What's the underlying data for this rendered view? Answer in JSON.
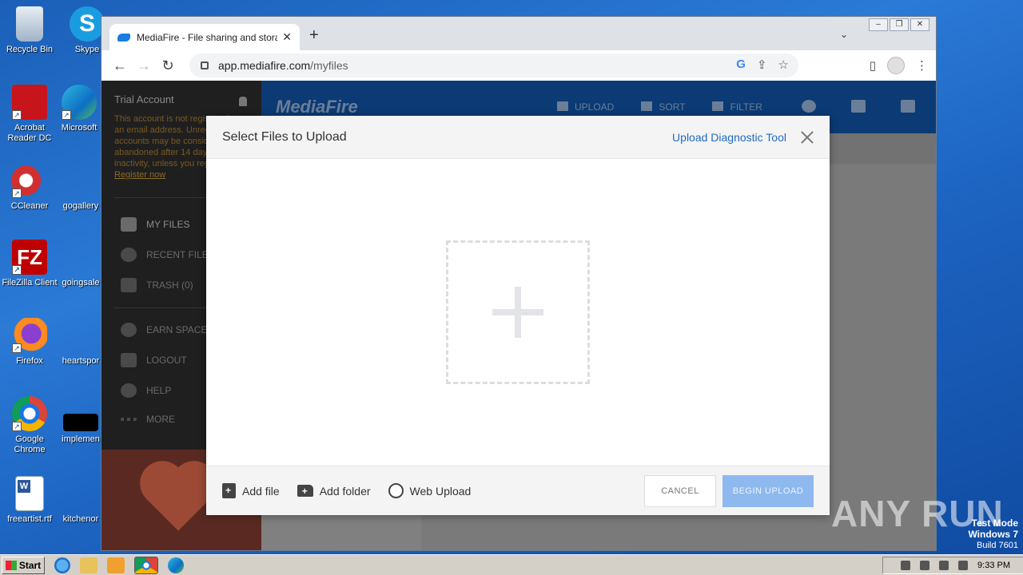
{
  "desktop": {
    "icons": [
      {
        "label": "Recycle Bin"
      },
      {
        "label": "Skype"
      },
      {
        "label": "Acrobat Reader DC"
      },
      {
        "label": "Microsoft"
      },
      {
        "label": "CCleaner"
      },
      {
        "label": "gogallery"
      },
      {
        "label": "FileZilla Client"
      },
      {
        "label": "goingsale"
      },
      {
        "label": "Firefox"
      },
      {
        "label": "heartspor"
      },
      {
        "label": "Google Chrome"
      },
      {
        "label": "implemen"
      },
      {
        "label": "freeartist.rtf"
      },
      {
        "label": "kitchenor"
      }
    ]
  },
  "browser": {
    "tab_title": "MediaFire - File sharing and storage",
    "url_host": "app.mediafire.com",
    "url_path": "/myfiles"
  },
  "mediafire": {
    "logo": "MediaFire",
    "sidebar": {
      "account_title": "Trial Account",
      "trial_notice": "This account is not registered to an email address. Unregistered accounts may be considered abandoned after 14 days of inactivity, unless you register.",
      "register_link": "Register now",
      "items": [
        {
          "label": "MY FILES"
        },
        {
          "label": "RECENT FILES"
        },
        {
          "label": "TRASH (0)"
        },
        {
          "label": "EARN SPACE"
        },
        {
          "label": "LOGOUT"
        },
        {
          "label": "HELP"
        },
        {
          "label": "MORE"
        }
      ]
    },
    "nav": {
      "upload": "UPLOAD",
      "sort": "SORT",
      "filter": "FILTER"
    }
  },
  "modal": {
    "title": "Select Files to Upload",
    "diagnostic_link": "Upload Diagnostic Tool",
    "add_file": "Add file",
    "add_folder": "Add folder",
    "web_upload": "Web Upload",
    "cancel": "CANCEL",
    "begin_upload": "BEGIN UPLOAD"
  },
  "watermark": "ANY RUN",
  "os_overlay": {
    "line1": "Test Mode",
    "line2": "Windows 7",
    "line3": "Build 7601"
  },
  "taskbar": {
    "start_label": "Start",
    "clock": "9:33 PM"
  },
  "colors": {
    "accent_link": "#1f6bc2",
    "begin_button": "#8eb9ef",
    "mf_header": "#0b3a74"
  }
}
